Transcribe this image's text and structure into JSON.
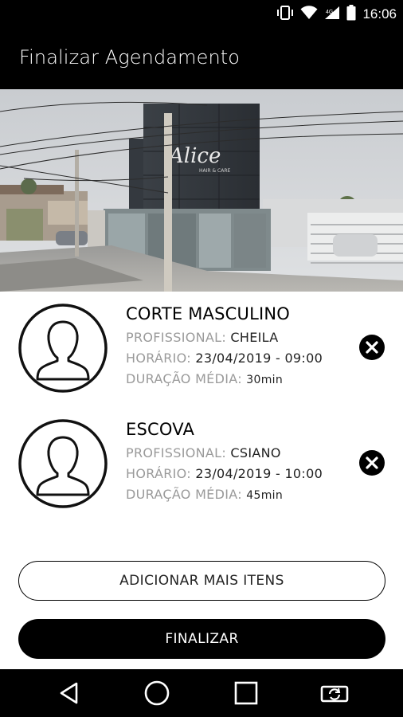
{
  "status_bar": {
    "time": "16:06",
    "icons": [
      "vibrate-icon",
      "wifi-icon",
      "signal-icon",
      "battery-icon"
    ]
  },
  "app_bar": {
    "title": "Finalizar Agendamento"
  },
  "hero": {
    "sign_text": "Alice",
    "sign_subtext": "HAIR & CARE"
  },
  "items": [
    {
      "service": "CORTE MASCULINO",
      "professional_label": "PROFISSIONAL:",
      "professional": "CHEILA",
      "time_label": "HORÁRIO:",
      "time": "23/04/2019 - 09:00",
      "duration_label": "DURAÇÃO MÉDIA:",
      "duration": "30min"
    },
    {
      "service": "ESCOVA",
      "professional_label": "PROFISSIONAL:",
      "professional": "CSIANO",
      "time_label": "HORÁRIO:",
      "time": "23/04/2019 - 10:00",
      "duration_label": "DURAÇÃO MÉDIA:",
      "duration": "45min"
    }
  ],
  "buttons": {
    "add_more": "ADICIONAR MAIS ITENS",
    "finish": "FINALIZAR"
  },
  "nav_bar": {
    "icons": [
      "back-icon",
      "home-icon",
      "recents-icon",
      "rotate-icon"
    ]
  },
  "colors": {
    "bar_background": "#000000",
    "label_gray": "#9a9a9a",
    "button_black": "#000000"
  }
}
